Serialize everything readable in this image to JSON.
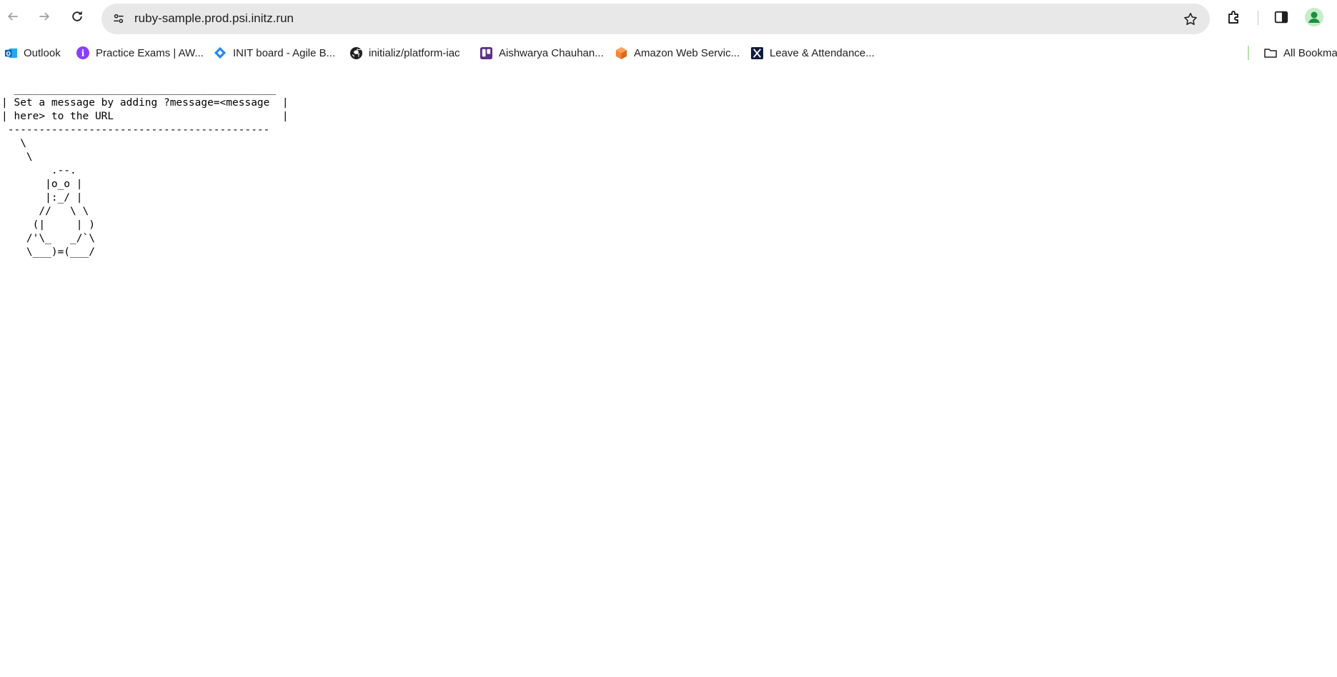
{
  "browser": {
    "url": "ruby-sample.prod.psi.initz.run"
  },
  "bookmarks": {
    "items": [
      {
        "label": "Outlook",
        "icon": "outlook-icon"
      },
      {
        "label": "Practice Exams | AW...",
        "icon": "practice-exams-icon"
      },
      {
        "label": "INIT board - Agile B...",
        "icon": "jira-icon"
      },
      {
        "label": "initializ/platform-iac",
        "icon": "github-icon"
      },
      {
        "label": "Aishwarya Chauhan...",
        "icon": "trello-icon"
      },
      {
        "label": "Amazon Web Servic...",
        "icon": "aws-icon"
      },
      {
        "label": "Leave & Attendance...",
        "icon": "x-logo-icon"
      }
    ],
    "all_bookmarks_label": "All Bookma"
  },
  "page": {
    "cowsay": "  __________________________________________\n| Set a message by adding ?message=<message  |\n| here> to the URL                           |\n ------------------------------------------\n   \\\n    \\\n        .--.\n       |o_o |\n       |:_/ |\n      //   \\ \\\n     (|     | )\n    /'\\_   _/`\\\n    \\___)=(___/"
  },
  "colors": {
    "omnibox_bg": "#e8e8e8",
    "profile_green": "#1e8e3e"
  }
}
